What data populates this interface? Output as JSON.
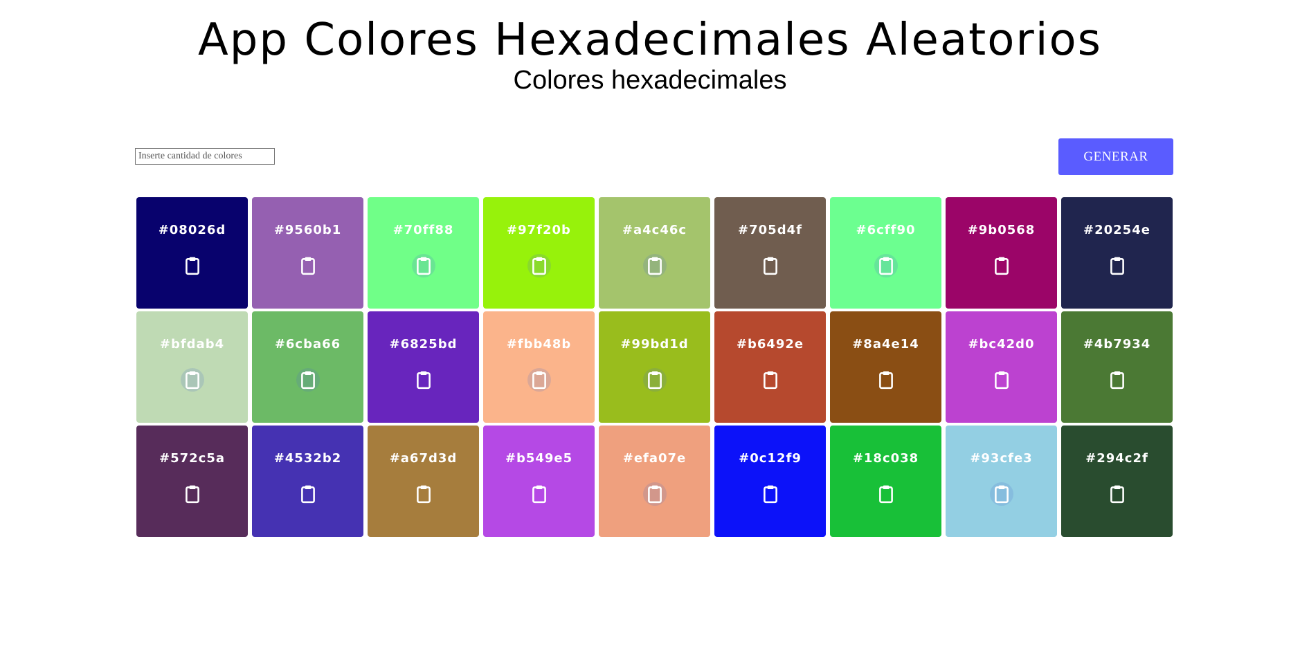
{
  "header": {
    "title": "App Colores Hexadecimales Aleatorios",
    "subtitle": "Colores hexadecimales"
  },
  "controls": {
    "input_placeholder": "Inserte cantidad de colores",
    "input_value": "",
    "generate_label": "GENERAR",
    "generate_color": "#5a5cff"
  },
  "colors": [
    {
      "label": "#08026d",
      "color": "#08026d"
    },
    {
      "label": "#9560b1",
      "color": "#9560b1"
    },
    {
      "label": "#70ff88",
      "color": "#70ff88"
    },
    {
      "label": "#97f20b",
      "color": "#97f20b"
    },
    {
      "label": "#a4c46c",
      "color": "#a4c46c"
    },
    {
      "label": "#705d4f",
      "color": "#705d4f"
    },
    {
      "label": "#6cff90",
      "color": "#6cff90"
    },
    {
      "label": "#9b0568",
      "color": "#9b0568"
    },
    {
      "label": "#20254e",
      "color": "#20254e"
    },
    {
      "label": "#bfdab4",
      "color": "#bfdab4"
    },
    {
      "label": "#6cba66",
      "color": "#6cba66"
    },
    {
      "label": "#6825bd",
      "color": "#6825bd"
    },
    {
      "label": "#fbb48b",
      "color": "#fbb48b"
    },
    {
      "label": "#99bd1d",
      "color": "#99bd1d"
    },
    {
      "label": "#b6492e",
      "color": "#b6492e"
    },
    {
      "label": "#8a4e14",
      "color": "#8a4e14"
    },
    {
      "label": "#bc42d0",
      "color": "#bc42d0"
    },
    {
      "label": "#4b7934",
      "color": "#4b7934"
    },
    {
      "label": "#572c5a",
      "color": "#572c5a"
    },
    {
      "label": "#4532b2",
      "color": "#4532b2"
    },
    {
      "label": "#a67d3d",
      "color": "#a67d3d"
    },
    {
      "label": "#b549e5",
      "color": "#b549e5"
    },
    {
      "label": "#efa07e",
      "color": "#efa07e"
    },
    {
      "label": "#0c12f9",
      "color": "#0c12f9"
    },
    {
      "label": "#18c038",
      "color": "#18c038"
    },
    {
      "label": "#93cfe3",
      "color": "#93cfe3"
    },
    {
      "label": "#294c2f",
      "color": "#294c2f"
    }
  ],
  "icons": {
    "copy": "clipboard-icon"
  }
}
